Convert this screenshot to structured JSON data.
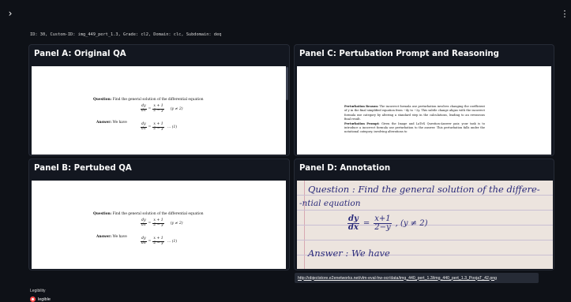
{
  "toolbar": {
    "collapse_icon": "chevron-right-icon",
    "menu_icon": "kebab-menu-icon"
  },
  "meta": {
    "line": "ID: 30, Custom-ID: img_449_pert_1.3, Grade: cl2, Domain: clc, Subdomain: deq"
  },
  "panels": {
    "a": {
      "title": "Panel A: Original QA",
      "question_label": "Question:",
      "question": "Find the general solution of the differential equation",
      "eq1_lhs_num": "dy",
      "eq1_lhs_den": "dx",
      "eq1_rhs_num": "x + 1",
      "eq1_rhs_den": "2 − y",
      "eq1_cond": "(y ≠ 2)",
      "answer_label": "Answer:",
      "answer": "We have",
      "eq2_lhs_num": "dy",
      "eq2_lhs_den": "dx",
      "eq2_rhs_num": "x + 1",
      "eq2_rhs_den": "2 − y",
      "eq2_tag": "… (1)"
    },
    "b": {
      "title": "Panel B: Pertubed QA",
      "question_label": "Question:",
      "question": "Find the general solution of the differential equation",
      "eq1_lhs_num": "dy",
      "eq1_lhs_den": "dx",
      "eq1_rhs_num": "x + 1",
      "eq1_rhs_den": "2 − y",
      "eq1_cond": "(y ≠ 2)",
      "answer_label": "Answer:",
      "answer": "We have",
      "eq2_lhs_num": "dy",
      "eq2_lhs_den": "dx",
      "eq2_rhs_num": "x + 1",
      "eq2_rhs_den": "2 − y",
      "eq2_tag": "… (1)"
    },
    "c": {
      "title": "Panel C: Pertubation Prompt and Reasoning",
      "reason_label": "Perturbation Reason:",
      "reason_text": "The incorrect formula use perturbation involves changing the coefficient of y in the final simplified equation from −4y to −2y. This subtle change aligns with the incorrect formula use category by altering a standard step in the calculations, leading to an erroneous final result.",
      "prompt_label": "Perturbation Prompt:",
      "prompt_text": "Given the Image and LaTeX Question-Answer pair, your task is to introduce a incorrect formula use perturbation to the answer. This perturbation falls under the notational category, involving alterations to"
    },
    "d": {
      "title": "Panel D: Annotation",
      "hand_line1": "Question : Find the general solution of the differe-",
      "hand_line2": "-ntial equation",
      "hand_eq_num": "dy",
      "hand_eq_den": "dx",
      "hand_eq_rhs_num": "x+1",
      "hand_eq_rhs_den": "2−y",
      "hand_eq_cond": ", (y ≠ 2)",
      "hand_line3": "Answer : We have"
    }
  },
  "url_tooltip": {
    "text": "http://objectstore.e2enetworks.net/vlm-eval-hw-ocr/data/img_440_pert_1.3/img_440_pert_1.3_PoojaT_42.png"
  },
  "legibility": {
    "label": "Legibility",
    "selected": "legible"
  }
}
